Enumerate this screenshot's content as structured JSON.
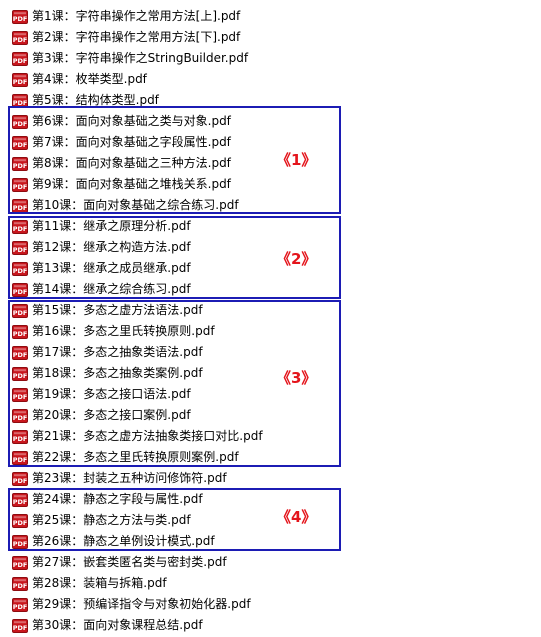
{
  "files": [
    "第1课：字符串操作之常用方法[上].pdf",
    "第2课：字符串操作之常用方法[下].pdf",
    "第3课：字符串操作之StringBuilder.pdf",
    "第4课：枚举类型.pdf",
    "第5课：结构体类型.pdf",
    "第6课：面向对象基础之类与对象.pdf",
    "第7课：面向对象基础之字段属性.pdf",
    "第8课：面向对象基础之三种方法.pdf",
    "第9课：面向对象基础之堆栈关系.pdf",
    "第10课：面向对象基础之综合练习.pdf",
    "第11课：继承之原理分析.pdf",
    "第12课：继承之构造方法.pdf",
    "第13课：继承之成员继承.pdf",
    "第14课：继承之综合练习.pdf",
    "第15课：多态之虚方法语法.pdf",
    "第16课：多态之里氏转换原则.pdf",
    "第17课：多态之抽象类语法.pdf",
    "第18课：多态之抽象类案例.pdf",
    "第19课：多态之接口语法.pdf",
    "第20课：多态之接口案例.pdf",
    "第21课：多态之虚方法抽象类接口对比.pdf",
    "第22课：多态之里氏转换原则案例.pdf",
    "第23课：封装之五种访问修饰符.pdf",
    "第24课：静态之字段与属性.pdf",
    "第25课：静态之方法与类.pdf",
    "第26课：静态之单例设计模式.pdf",
    "第27课：嵌套类匿名类与密封类.pdf",
    "第28课：装箱与拆箱.pdf",
    "第29课：预编译指令与对象初始化器.pdf",
    "第30课：面向对象课程总结.pdf"
  ],
  "groups": [
    {
      "label": "《1》"
    },
    {
      "label": "《2》"
    },
    {
      "label": "《3》"
    },
    {
      "label": "《4》"
    }
  ],
  "icon": "pdf-file-icon",
  "colors": {
    "box": "#1c1cb4",
    "label": "#e4141b",
    "icon": "#c8161d"
  }
}
